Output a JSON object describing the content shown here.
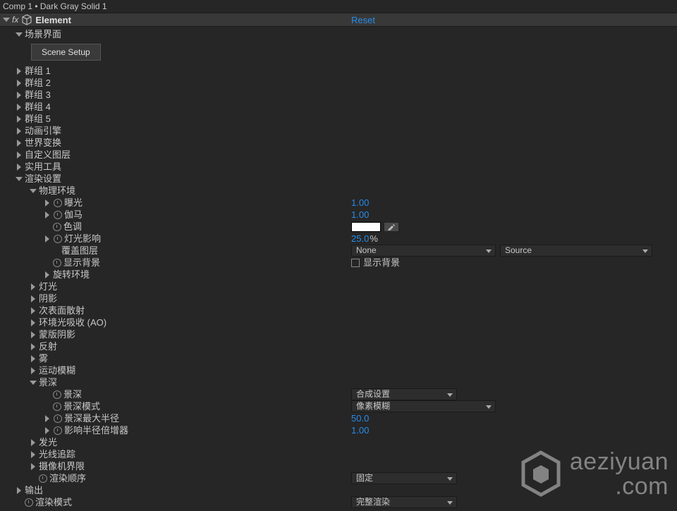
{
  "header": {
    "breadcrumb": "Comp 1 • Dark Gray Solid 1",
    "fx_prefix": "fx",
    "effect_name": "Element",
    "reset_label": "Reset"
  },
  "scene_interface": {
    "label": "场景界面",
    "scene_setup_btn": "Scene Setup"
  },
  "groups": {
    "g1": "群组 1",
    "g2": "群组 2",
    "g3": "群组 3",
    "g4": "群组 4",
    "g5": "群组 5"
  },
  "sections": {
    "anim_engine": "动画引擎",
    "world_transform": "世界变换",
    "custom_layers": "自定义图层",
    "utilities": "实用工具",
    "render_settings": "渲染设置",
    "output": "输出"
  },
  "render": {
    "physical_env": "物理环境",
    "exposure": {
      "label": "曝光",
      "value": "1.00"
    },
    "gamma": {
      "label": "伽马",
      "value": "1.00"
    },
    "tint": {
      "label": "色调",
      "color": "#FFFFFF"
    },
    "light_influence": {
      "label": "灯光影响",
      "value": "25.0",
      "suffix": "%"
    },
    "override_layer": {
      "label": "覆盖图层",
      "dd_none": "None",
      "dd_source": "Source"
    },
    "show_bg": {
      "label": "显示背景",
      "cb_label": "显示背景"
    },
    "rotate_env": "旋转环境",
    "lighting": "灯光",
    "shadows": "阴影",
    "subsurface": "次表面散射",
    "ao": "环境光吸收 (AO)",
    "matte_shadow": "蒙版阴影",
    "reflection": "反射",
    "fog": "雾",
    "motion_blur": "运动模糊",
    "dof": {
      "label": "景深",
      "dof_prop": "景深",
      "dof_mode": "景深模式",
      "dof_max_radius": "景深最大半径",
      "dof_radius_mult": "影响半径倍增器",
      "dd_comp": "合成设置",
      "dd_pixel": "像素模糊",
      "val_max": "50.0",
      "val_mult": "1.00"
    },
    "glow": "发光",
    "raytrace": "光线追踪",
    "camera_limits": "摄像机界限",
    "render_order": {
      "label": "渲染顺序",
      "dd": "固定"
    },
    "render_mode": {
      "label": "渲染模式",
      "dd": "完整渲染"
    }
  },
  "watermark": {
    "line1": "aeziyuan",
    "line2": ".com"
  }
}
